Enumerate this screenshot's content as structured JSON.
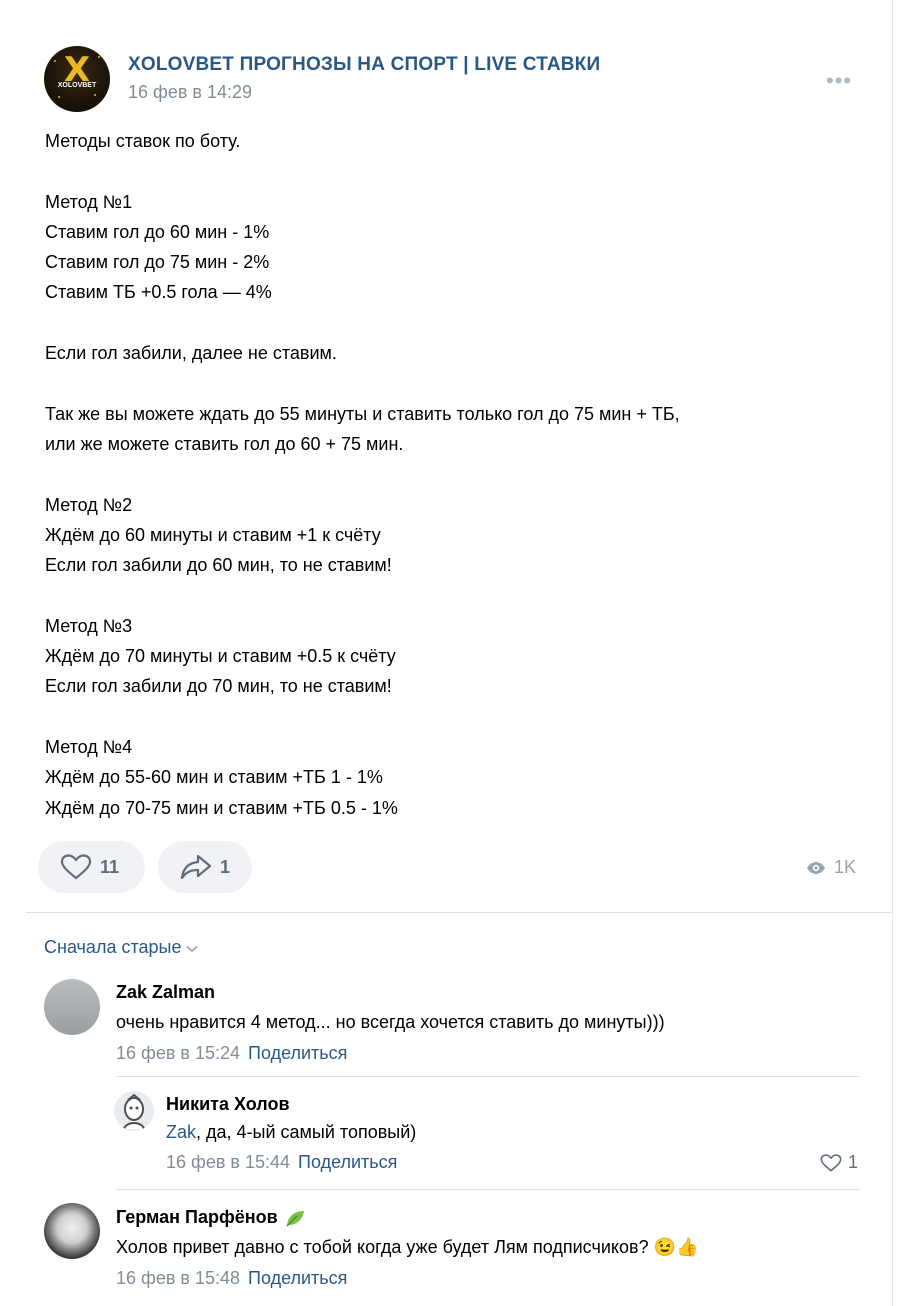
{
  "post": {
    "author": "XOLOVBET ПРОГНОЗЫ НА СПОРТ | LIVE СТАВКИ",
    "avatar_letter": "X",
    "avatar_brand": "XOLOVBET",
    "date": "16 фев в 14:29",
    "more_label": "•••",
    "lines": [
      "Методы ставок по боту.",
      "",
      "Метод №1",
      "Ставим гол до 60 мин - 1%",
      "Ставим гол до 75 мин - 2%",
      "Ставим ТБ +0.5 гола — 4%",
      "",
      "Если гол забили, далее не ставим.",
      "",
      "Так же вы можете ждать до 55 минуты и ставить только гол до 75 мин + ТБ,",
      "или же можете ставить гол до 60 + 75 мин.",
      "",
      "Метод №2",
      "Ждём до 60 минуты и ставим +1 к счёту",
      "Если гол забили до 60 мин, то не ставим!",
      "",
      "Метод №3",
      "Ждём до 70 минуты и ставим +0.5 к счёту",
      "Если гол забили до 70 мин, то не ставим!",
      "",
      "Метод №4",
      "Ждём до 55-60 мин и ставим +ТБ 1 - 1%",
      "Ждём до 70-75 мин и ставим +ТБ 0.5 - 1%"
    ],
    "likes": "11",
    "shares": "1",
    "views": "1K"
  },
  "comments_section": {
    "sort_label": "Сначала старые"
  },
  "comments": [
    {
      "name": "Zak Zalman",
      "text": "очень нравится 4 метод... но всегда хочется ставить до минуты)))",
      "date": "16 фев в 15:24",
      "share": "Поделиться"
    },
    {
      "name": "Никита Холов",
      "mention": "Zak",
      "text": ", да, 4-ый самый топовый)",
      "date": "16 фев в 15:44",
      "share": "Поделиться",
      "likes": "1"
    },
    {
      "name": "Герман Парфёнов",
      "text": "Холов привет давно с тобой когда уже будет Лям подписчиков? ",
      "emoji": "😉👍",
      "date": "16 фев в 15:48",
      "share": "Поделиться"
    }
  ],
  "icons": {
    "like": "heart-icon",
    "share": "share-arrow-icon",
    "views": "eye-icon",
    "sort": "chevron-down-icon",
    "badge": "leaf-icon"
  },
  "colors": {
    "link": "#2a5885",
    "meta": "#818c99",
    "button_bg": "#f0f2f5"
  }
}
